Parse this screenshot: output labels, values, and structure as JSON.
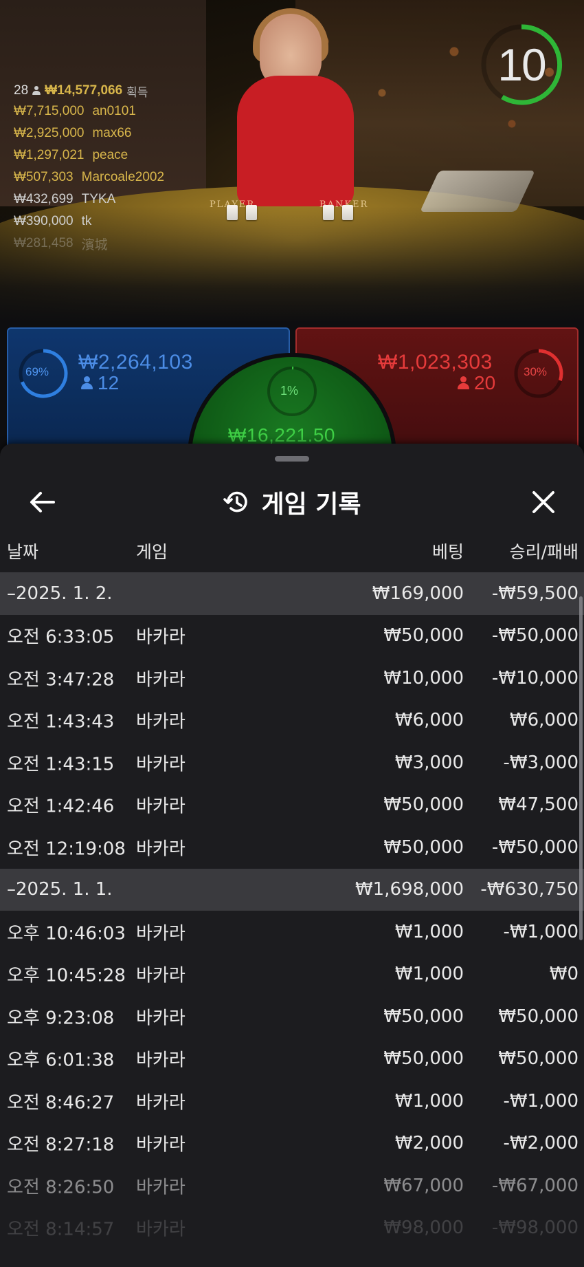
{
  "timer": {
    "seconds": "10"
  },
  "leaderboard": {
    "count": "28",
    "total": "₩14,577,066",
    "total_label": "획득",
    "entries": [
      {
        "amount": "₩7,715,000",
        "name": "an0101"
      },
      {
        "amount": "₩2,925,000",
        "name": "max66"
      },
      {
        "amount": "₩1,297,021",
        "name": "peace"
      },
      {
        "amount": "₩507,303",
        "name": "Marcoale2002"
      },
      {
        "amount": "₩432,699",
        "name": "TYKA"
      },
      {
        "amount": "₩390,000",
        "name": "tk"
      },
      {
        "amount": "₩281,458",
        "name": "濱城"
      }
    ]
  },
  "table": {
    "player_label": "PLAYER",
    "banker_label": "BANKER"
  },
  "bets": {
    "player": {
      "percent": "69%",
      "amount": "₩2,264,103",
      "players": "12",
      "ratio": 0.69,
      "color": "#2f7fe0"
    },
    "banker": {
      "percent": "30%",
      "amount": "₩1,023,303",
      "players": "20",
      "ratio": 0.3,
      "color": "#e03030"
    },
    "tie": {
      "percent": "1%",
      "amount": "₩16,221.50",
      "ratio": 0.01,
      "color": "#36c23e"
    }
  },
  "sheet": {
    "title": "게임 기록",
    "columns": {
      "date": "날짜",
      "game": "게임",
      "bet": "베팅",
      "win_loss": "승리/패배"
    },
    "rows": [
      {
        "type": "group",
        "date": "–2025. 1. 2.",
        "game": "",
        "bet": "₩169,000",
        "result": "-₩59,500"
      },
      {
        "type": "entry",
        "date": "오전 6:33:05",
        "game": "바카라",
        "bet": "₩50,000",
        "result": "-₩50,000"
      },
      {
        "type": "entry",
        "date": "오전 3:47:28",
        "game": "바카라",
        "bet": "₩10,000",
        "result": "-₩10,000"
      },
      {
        "type": "entry",
        "date": "오전 1:43:43",
        "game": "바카라",
        "bet": "₩6,000",
        "result": "₩6,000"
      },
      {
        "type": "entry",
        "date": "오전 1:43:15",
        "game": "바카라",
        "bet": "₩3,000",
        "result": "-₩3,000"
      },
      {
        "type": "entry",
        "date": "오전 1:42:46",
        "game": "바카라",
        "bet": "₩50,000",
        "result": "₩47,500"
      },
      {
        "type": "entry",
        "date": "오전 12:19:08",
        "game": "바카라",
        "bet": "₩50,000",
        "result": "-₩50,000"
      },
      {
        "type": "group",
        "date": "–2025. 1. 1.",
        "game": "",
        "bet": "₩1,698,000",
        "result": "-₩630,750"
      },
      {
        "type": "entry",
        "date": "오후 10:46:03",
        "game": "바카라",
        "bet": "₩1,000",
        "result": "-₩1,000"
      },
      {
        "type": "entry",
        "date": "오후 10:45:28",
        "game": "바카라",
        "bet": "₩1,000",
        "result": "₩0"
      },
      {
        "type": "entry",
        "date": "오후 9:23:08",
        "game": "바카라",
        "bet": "₩50,000",
        "result": "₩50,000"
      },
      {
        "type": "entry",
        "date": "오후 6:01:38",
        "game": "바카라",
        "bet": "₩50,000",
        "result": "₩50,000"
      },
      {
        "type": "entry",
        "date": "오전 8:46:27",
        "game": "바카라",
        "bet": "₩1,000",
        "result": "-₩1,000"
      },
      {
        "type": "entry",
        "date": "오전 8:27:18",
        "game": "바카라",
        "bet": "₩2,000",
        "result": "-₩2,000"
      },
      {
        "type": "entry",
        "date": "오전 8:26:50",
        "game": "바카라",
        "bet": "₩67,000",
        "result": "-₩67,000"
      },
      {
        "type": "entry",
        "date": "오전 8:14:57",
        "game": "바카라",
        "bet": "₩98,000",
        "result": "-₩98,000"
      }
    ]
  },
  "icons": {
    "back": "arrow-left-icon",
    "history": "history-clock-icon",
    "close": "close-icon"
  }
}
